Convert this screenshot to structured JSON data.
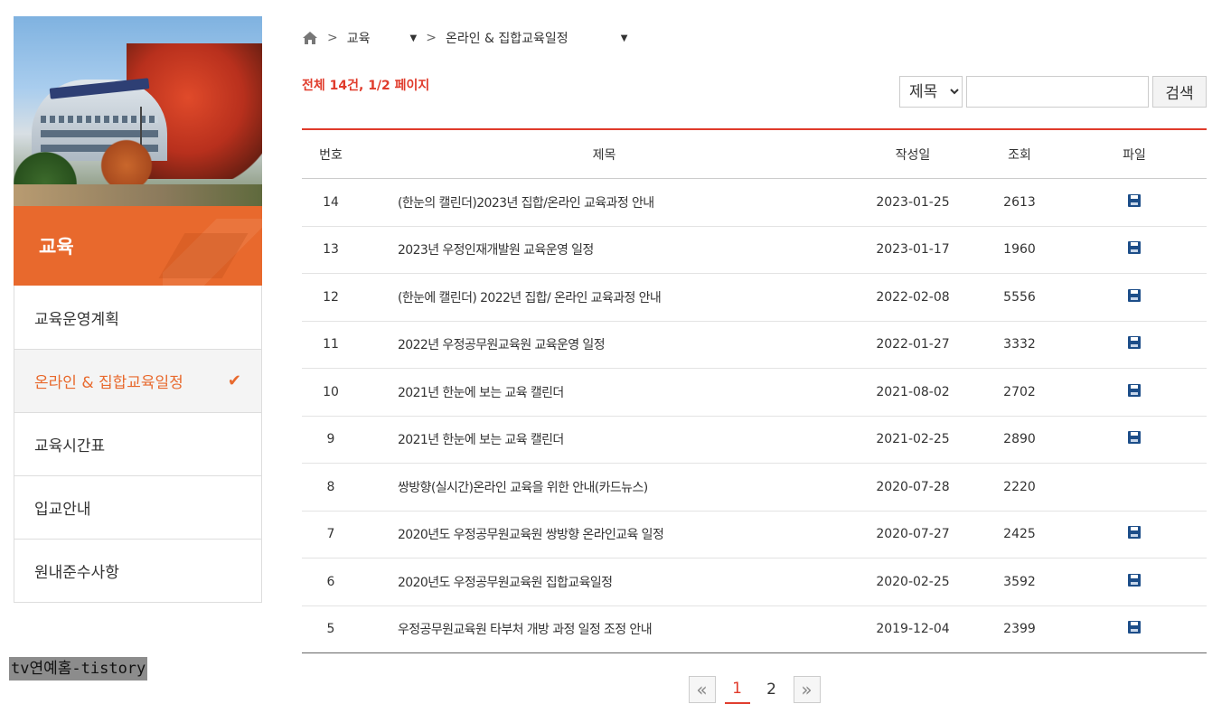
{
  "sidebar": {
    "title": "교육",
    "items": [
      {
        "label": "교육운영계획",
        "active": false
      },
      {
        "label": "온라인 & 집합교육일정",
        "active": true
      },
      {
        "label": "교육시간표",
        "active": false
      },
      {
        "label": "입교안내",
        "active": false
      },
      {
        "label": "원내준수사항",
        "active": false
      }
    ],
    "active_mark": "✔"
  },
  "breadcrumb": {
    "sep": ">",
    "level1": "교육",
    "level2": "온라인 & 집합교육일정"
  },
  "summary": "전체 14건, 1/2 페이지",
  "search": {
    "field_option": "제목",
    "query": "",
    "button_label": "검색"
  },
  "table": {
    "headers": [
      "번호",
      "제목",
      "작성일",
      "조회",
      "파일"
    ],
    "rows": [
      {
        "no": "14",
        "title": "(한눈의 캘린더)2023년 집합/온라인 교육과정 안내",
        "date": "2023-01-25",
        "views": "2613",
        "file": true
      },
      {
        "no": "13",
        "title": "2023년 우정인재개발원 교육운영 일정",
        "date": "2023-01-17",
        "views": "1960",
        "file": true
      },
      {
        "no": "12",
        "title": "(한눈에 캘린더) 2022년 집합/ 온라인 교육과정 안내",
        "date": "2022-02-08",
        "views": "5556",
        "file": true
      },
      {
        "no": "11",
        "title": "2022년 우정공무원교육원 교육운영 일정",
        "date": "2022-01-27",
        "views": "3332",
        "file": true
      },
      {
        "no": "10",
        "title": "2021년 한눈에 보는 교육 캘린더",
        "date": "2021-08-02",
        "views": "2702",
        "file": true
      },
      {
        "no": "9",
        "title": "2021년 한눈에 보는 교육 캘린더",
        "date": "2021-02-25",
        "views": "2890",
        "file": true
      },
      {
        "no": "8",
        "title": "쌍방향(실시간)온라인 교육을 위한 안내(카드뉴스)",
        "date": "2020-07-28",
        "views": "2220",
        "file": false
      },
      {
        "no": "7",
        "title": "2020년도 우정공무원교육원 쌍방향 온라인교육 일정",
        "date": "2020-07-27",
        "views": "2425",
        "file": true
      },
      {
        "no": "6",
        "title": "2020년도 우정공무원교육원 집합교육일정",
        "date": "2020-02-25",
        "views": "3592",
        "file": true
      },
      {
        "no": "5",
        "title": "우정공무원교육원 타부처 개방 과정 일정 조정 안내",
        "date": "2019-12-04",
        "views": "2399",
        "file": true
      }
    ]
  },
  "pagination": {
    "prev": "«",
    "pages": [
      "1",
      "2"
    ],
    "current": "1",
    "next": "»"
  },
  "watermark": "tv연예홈-tistory",
  "colors": {
    "accent": "#e8692d",
    "highlight": "#e03b2b",
    "file_icon": "#1d4e89"
  }
}
